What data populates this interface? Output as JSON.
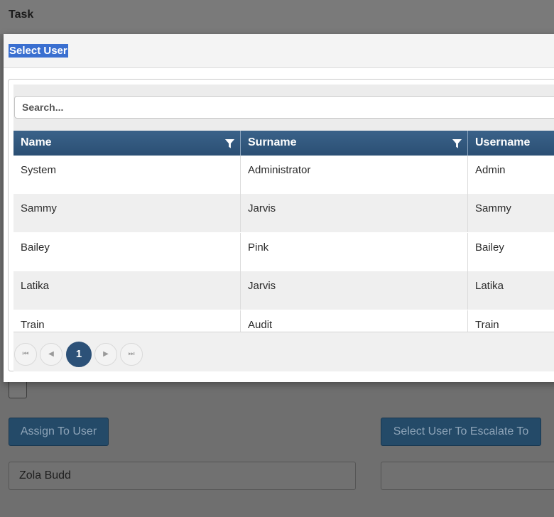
{
  "page": {
    "title": "Task",
    "assign_button_label": "Assign To User",
    "escalate_button_label": "Select User To Escalate To",
    "assigned_user_value": "Zola Budd",
    "escalate_user_value": ""
  },
  "modal": {
    "title": "Select User",
    "search": {
      "placeholder": "Search...",
      "value": ""
    },
    "columns": {
      "name": "Name",
      "surname": "Surname",
      "username": "Username"
    },
    "rows": [
      {
        "name": "System",
        "surname": "Administrator",
        "username": "Admin"
      },
      {
        "name": "Sammy",
        "surname": "Jarvis",
        "username": "Sammy"
      },
      {
        "name": "Bailey",
        "surname": "Pink",
        "username": "Bailey"
      },
      {
        "name": "Latika",
        "surname": "Jarvis",
        "username": "Latika"
      },
      {
        "name": "Train",
        "surname": "Audit",
        "username": "Train"
      }
    ],
    "pager": {
      "first_icon": "first-page-icon",
      "prev_icon": "prev-page-icon",
      "current_page": "1",
      "next_icon": "next-page-icon",
      "last_icon": "last-page-icon"
    }
  },
  "colors": {
    "header_blue": "#2b4f74",
    "primary_button": "#244a68",
    "selection_highlight": "#3a6fd0",
    "row_alt": "#efefef"
  }
}
